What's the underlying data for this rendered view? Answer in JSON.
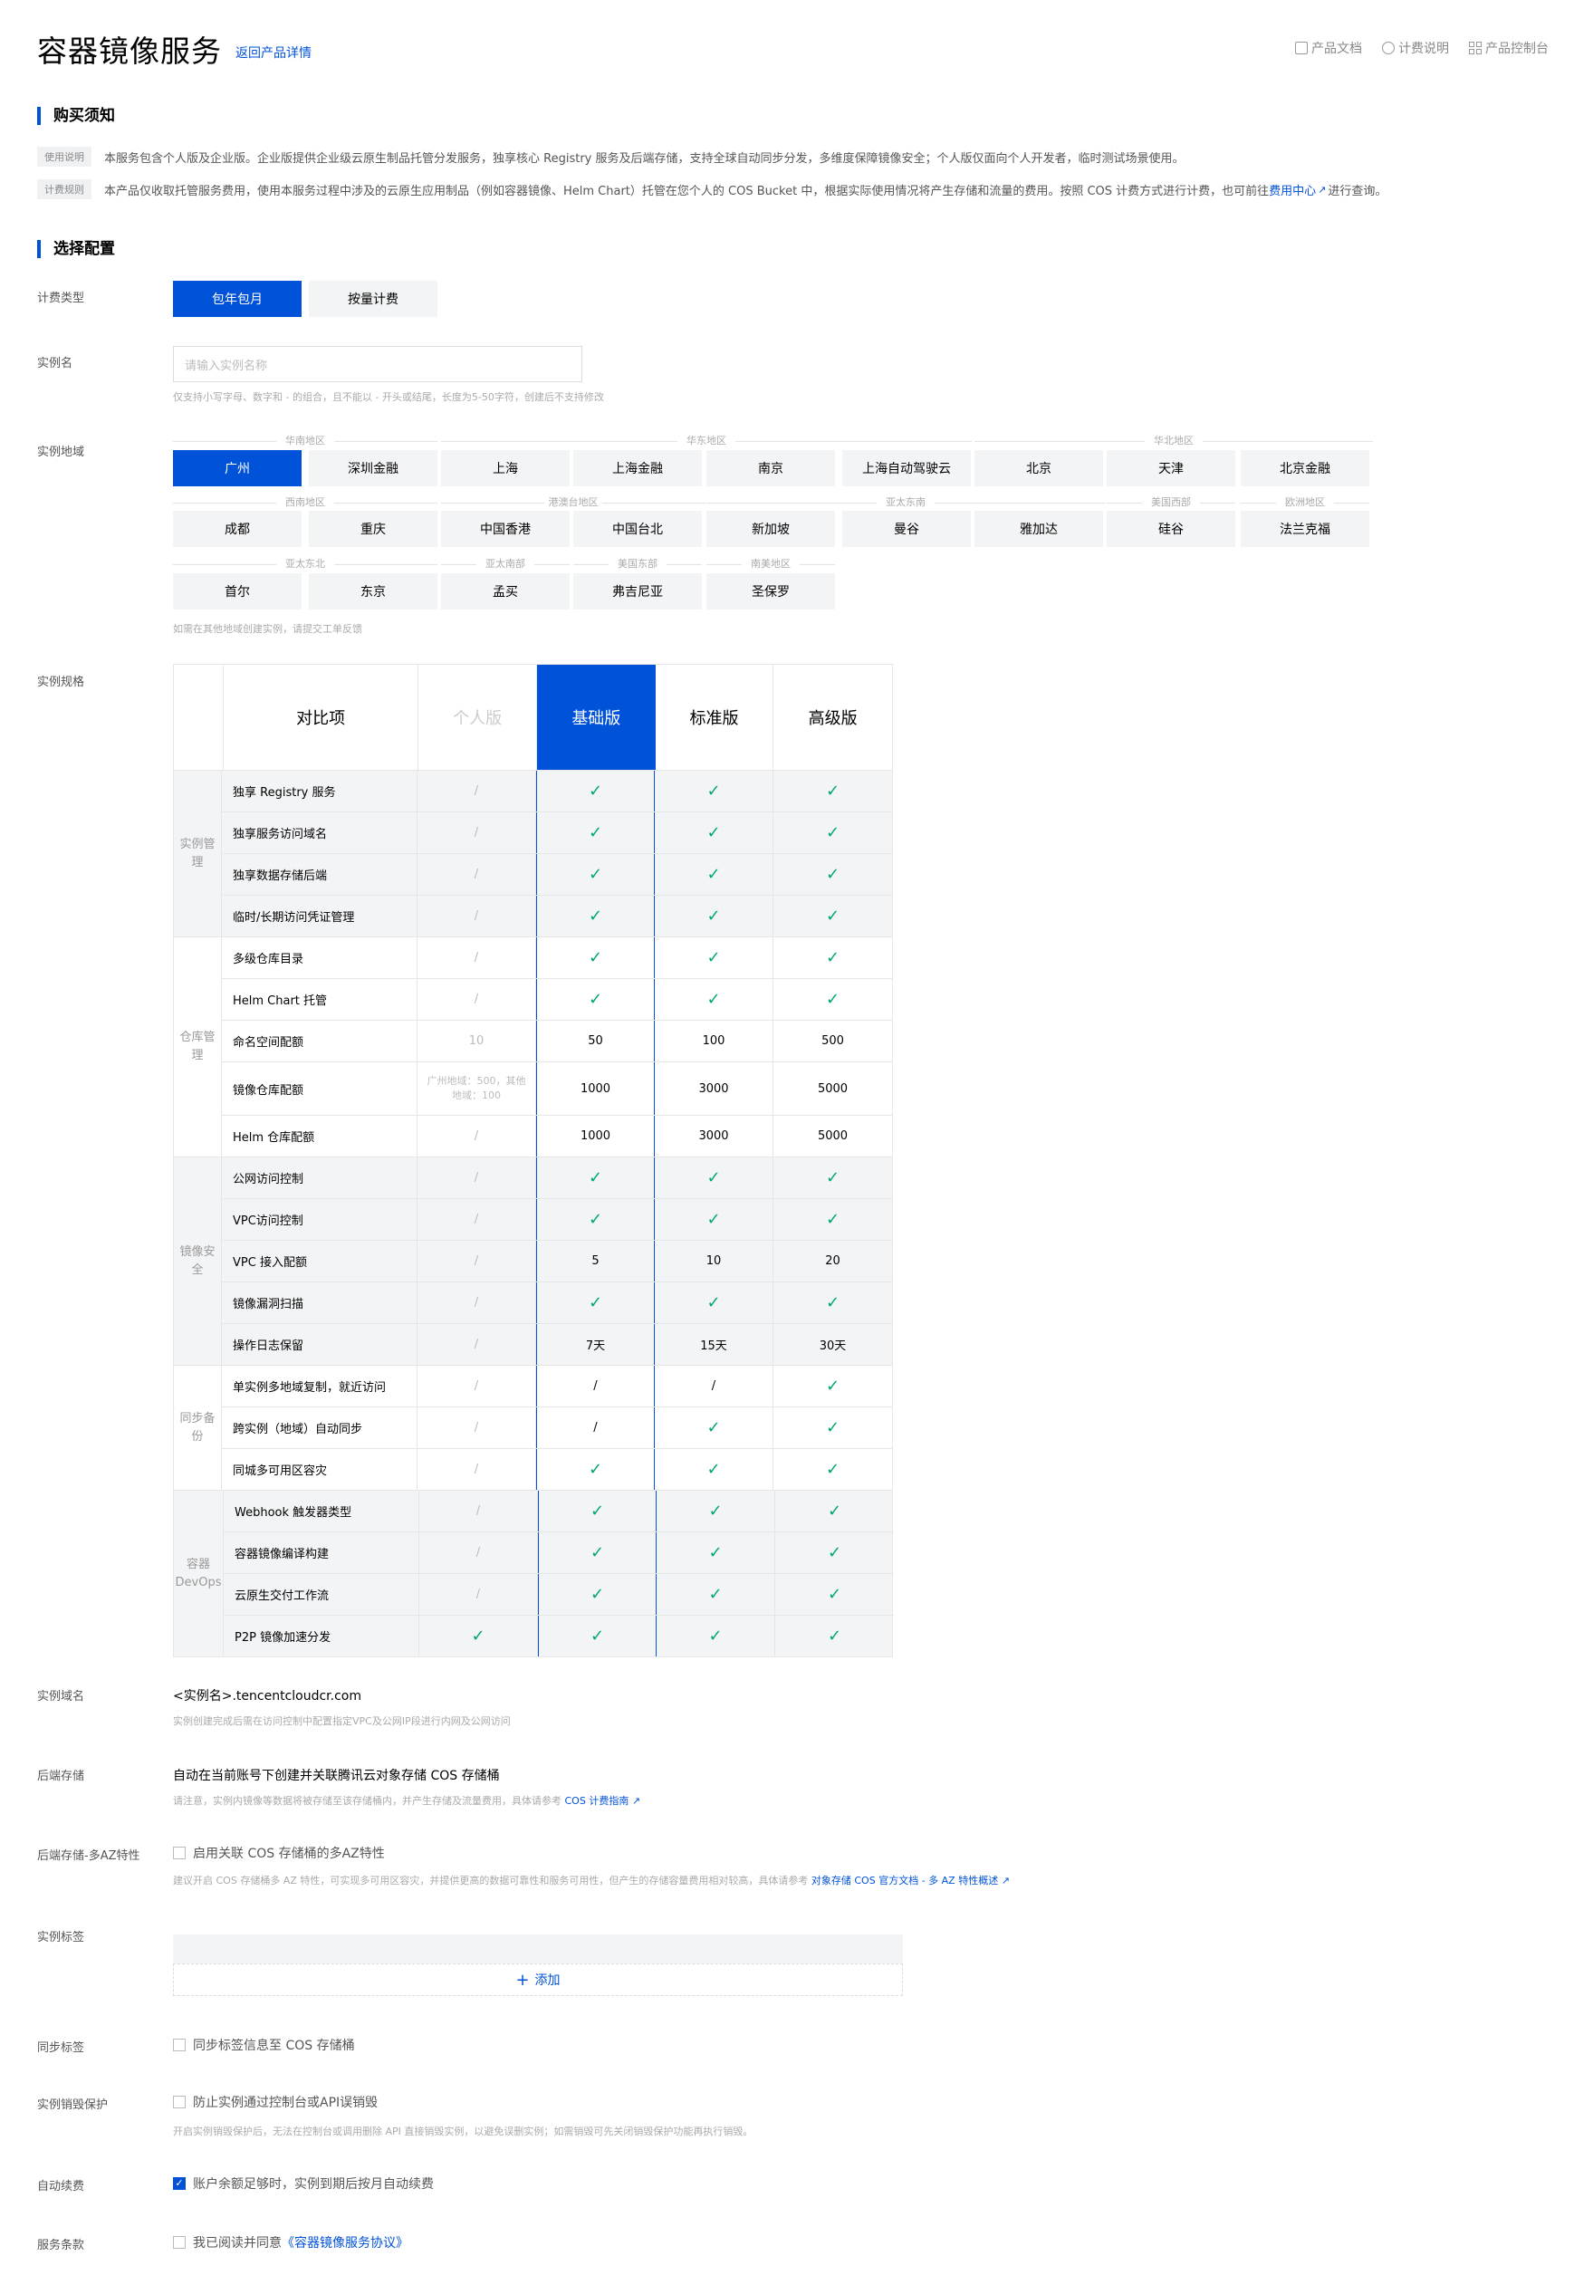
{
  "header": {
    "title": "容器镜像服务",
    "back_link": "返回产品详情",
    "links": [
      "产品文档",
      "计费说明",
      "产品控制台"
    ]
  },
  "notice": {
    "title": "购买须知",
    "items": [
      {
        "tag": "使用说明",
        "text": "本服务包含个人版及企业版。企业版提供企业级云原生制品托管分发服务，独享核心 Registry 服务及后端存储，支持全球自动同步分发，多维度保障镜像安全；个人版仅面向个人开发者，临时测试场景使用。"
      },
      {
        "tag": "计费规则",
        "text": "本产品仅收取托管服务费用，使用本服务过程中涉及的云原生应用制品（例如容器镜像、Helm Chart）托管在您个人的 COS Bucket 中，根据实际使用情况将产生存储和流量的费用。按照 COS 计费方式进行计费，也可前往",
        "link": "费用中心",
        "tail": "进行查询。"
      }
    ]
  },
  "config": {
    "title": "选择配置",
    "billing": {
      "label": "计费类型",
      "options": [
        "包年包月",
        "按量计费"
      ],
      "selected": "包年包月"
    },
    "instance_name": {
      "label": "实例名",
      "placeholder": "请输入实例名称",
      "hint": "仅支持小写字母、数字和 - 的组合，且不能以 - 开头或结尾，长度为5-50字符，创建后不支持修改"
    },
    "region": {
      "label": "实例地域",
      "hint": "如需在其他地域创建实例，请提交工单反馈",
      "selected": "广州",
      "row1_groups": [
        "华南地区",
        "华东地区",
        "华北地区"
      ],
      "row1": [
        "广州",
        "深圳金融",
        "上海",
        "上海金融",
        "南京",
        "上海自动驾驶云",
        "北京",
        "天津",
        "北京金融"
      ],
      "row2_groups": [
        "西南地区",
        "港澳台地区",
        "亚太东南",
        "美国西部",
        "欧洲地区"
      ],
      "row2": [
        "成都",
        "重庆",
        "中国香港",
        "中国台北",
        "新加坡",
        "曼谷",
        "雅加达",
        "硅谷",
        "法兰克福"
      ],
      "row3_groups": [
        "亚太东北",
        "亚太南部",
        "美国东部",
        "南美地区"
      ],
      "row3": [
        "首尔",
        "东京",
        "孟买",
        "弗吉尼亚",
        "圣保罗"
      ]
    },
    "spec": {
      "label": "实例规格",
      "headers": [
        "对比项",
        "个人版",
        "基础版",
        "标准版",
        "高级版"
      ],
      "groups": [
        {
          "name": "实例管理",
          "rows": [
            [
              "独享 Registry 服务",
              "/",
              "✓",
              "✓",
              "✓"
            ],
            [
              "独享服务访问域名",
              "/",
              "✓",
              "✓",
              "✓"
            ],
            [
              "独享数据存储后端",
              "/",
              "✓",
              "✓",
              "✓"
            ],
            [
              "临时/长期访问凭证管理",
              "/",
              "✓",
              "✓",
              "✓"
            ]
          ]
        },
        {
          "name": "仓库管理",
          "rows": [
            [
              "多级仓库目录",
              "/",
              "✓",
              "✓",
              "✓"
            ],
            [
              "Helm Chart 托管",
              "/",
              "✓",
              "✓",
              "✓"
            ],
            [
              "命名空间配额",
              "10",
              "50",
              "100",
              "500"
            ],
            [
              "镜像仓库配额",
              "广州地域：500，其他地域：100",
              "1000",
              "3000",
              "5000"
            ],
            [
              "Helm 仓库配额",
              "/",
              "1000",
              "3000",
              "5000"
            ]
          ]
        },
        {
          "name": "镜像安全",
          "rows": [
            [
              "公网访问控制",
              "/",
              "✓",
              "✓",
              "✓"
            ],
            [
              "VPC访问控制",
              "/",
              "✓",
              "✓",
              "✓"
            ],
            [
              "VPC 接入配额",
              "/",
              "5",
              "10",
              "20"
            ],
            [
              "镜像漏洞扫描",
              "/",
              "✓",
              "✓",
              "✓"
            ],
            [
              "操作日志保留",
              "/",
              "7天",
              "15天",
              "30天"
            ]
          ]
        },
        {
          "name": "同步备份",
          "rows": [
            [
              "单实例多地域复制，就近访问",
              "/",
              "/",
              "/",
              "✓"
            ],
            [
              "跨实例（地域）自动同步",
              "/",
              "/",
              "✓",
              "✓"
            ],
            [
              "同城多可用区容灾",
              "/",
              "✓",
              "✓",
              "✓"
            ]
          ]
        },
        {
          "name": "容器 DevOps",
          "rows": [
            [
              "Webhook 触发器类型",
              "/",
              "✓",
              "✓",
              "✓"
            ],
            [
              "容器镜像编译构建",
              "/",
              "✓",
              "✓",
              "✓"
            ],
            [
              "云原生交付工作流",
              "/",
              "✓",
              "✓",
              "✓"
            ],
            [
              "P2P 镜像加速分发",
              "✓",
              "✓",
              "✓",
              "✓"
            ]
          ]
        }
      ]
    },
    "domain": {
      "label": "实例域名",
      "value": "<实例名>.tencentcloudcr.com",
      "hint": "实例创建完成后需在访问控制中配置指定VPC及公网IP段进行内网及公网访问"
    },
    "backend": {
      "label": "后端存储",
      "value": "自动在当前账号下创建并关联腾讯云对象存储 COS 存储桶",
      "hint": "请注意，实例内镜像等数据将被存储至该存储桶内，并产生存储及流量费用，具体请参考",
      "hint_link": "COS 计费指南"
    },
    "multi_az": {
      "label": "后端存储-多AZ特性",
      "check_label": "启用关联 COS 存储桶的多AZ特性",
      "hint": "建议开启 COS 存储桶多 AZ 特性，可实现多可用区容灾，并提供更高的数据可靠性和服务可用性，但产生的存储容量费用相对较高，具体请参考",
      "hint_link": "对象存储 COS 官方文档 - 多 AZ 特性概述"
    },
    "tags": {
      "label": "实例标签",
      "add": "添加"
    },
    "sync_tags": {
      "label": "同步标签",
      "check_label": "同步标签信息至 COS 存储桶"
    },
    "protect": {
      "label": "实例销毁保护",
      "check_label": "防止实例通过控制台或API误销毁",
      "hint": "开启实例销毁保护后，无法在控制台或调用删除 API 直接销毁实例，以避免误删实例；如需销毁可先关闭销毁保护功能再执行销毁。"
    },
    "renew": {
      "label": "自动续费",
      "check_label": "账户余额足够时，实例到期后按月自动续费",
      "checked": true
    },
    "terms": {
      "label": "服务条款",
      "prefix": "我已阅读并同意",
      "link": "《容器镜像服务协议》"
    }
  }
}
